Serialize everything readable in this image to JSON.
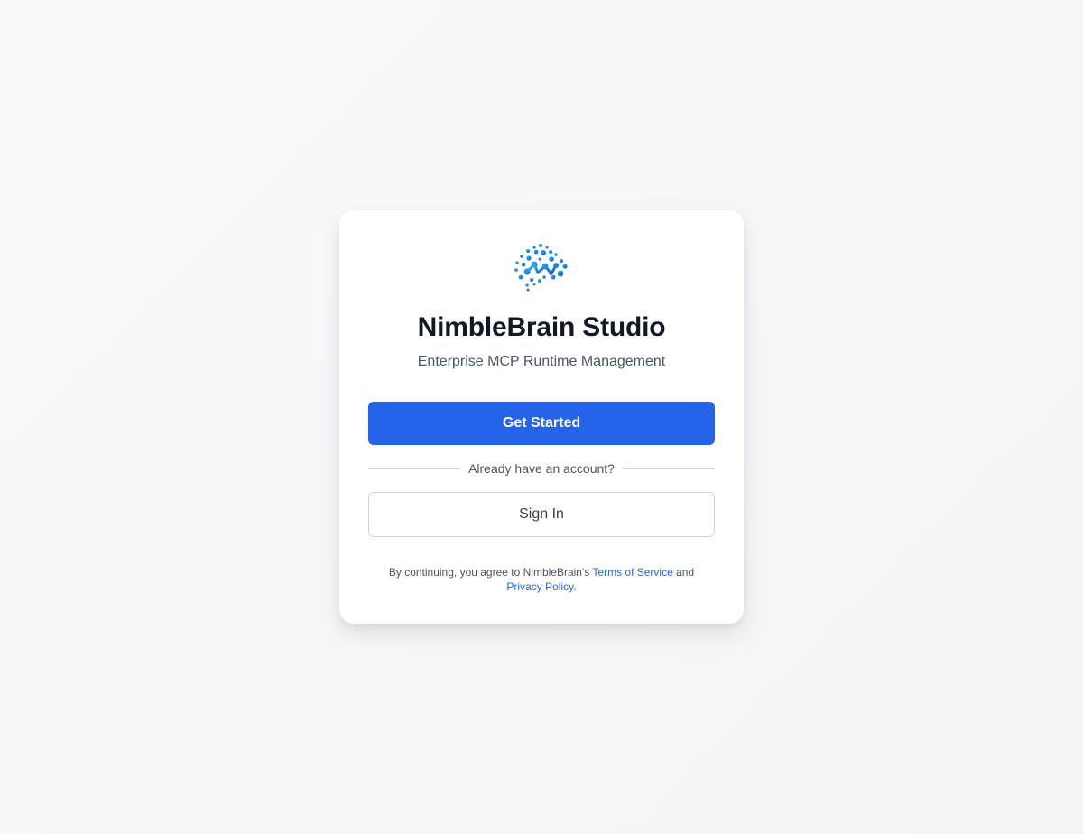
{
  "app": {
    "logo_icon": "nimblebrain-dots-logo-icon",
    "title": "NimbleBrain Studio",
    "subtitle": "Enterprise MCP Runtime Management"
  },
  "actions": {
    "primary_label": "Get Started",
    "divider_text": "Already have an account?",
    "secondary_label": "Sign In"
  },
  "legal": {
    "prefix": "By continuing, you agree to NimbleBrain's",
    "terms_label": "Terms of Service",
    "conjunction": "and",
    "privacy_label": "Privacy Policy",
    "suffix": "."
  },
  "colors": {
    "accent": "#2563eb",
    "title": "#111827",
    "muted": "#4b5563",
    "logo_light": "#22c3f3",
    "logo_dark": "#1d4ed8"
  }
}
